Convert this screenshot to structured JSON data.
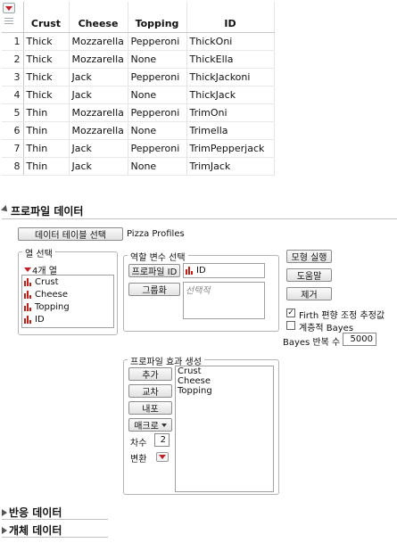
{
  "table": {
    "columns": [
      "Crust",
      "Cheese",
      "Topping",
      "ID"
    ],
    "rows": [
      {
        "n": "1",
        "cells": [
          "Thick",
          "Mozzarella",
          "Pepperoni",
          "ThickOni"
        ]
      },
      {
        "n": "2",
        "cells": [
          "Thick",
          "Mozzarella",
          "None",
          "ThickElla"
        ]
      },
      {
        "n": "3",
        "cells": [
          "Thick",
          "Jack",
          "Pepperoni",
          "ThickJackoni"
        ]
      },
      {
        "n": "4",
        "cells": [
          "Thick",
          "Jack",
          "None",
          "ThickJack"
        ]
      },
      {
        "n": "5",
        "cells": [
          "Thin",
          "Mozzarella",
          "Pepperoni",
          "TrimOni"
        ]
      },
      {
        "n": "6",
        "cells": [
          "Thin",
          "Mozzarella",
          "None",
          "Trimella"
        ]
      },
      {
        "n": "7",
        "cells": [
          "Thin",
          "Jack",
          "Pepperoni",
          "TrimPepperjack"
        ]
      },
      {
        "n": "8",
        "cells": [
          "Thin",
          "Jack",
          "None",
          "TrimJack"
        ]
      }
    ]
  },
  "profile": {
    "title": "프로파일 데이터",
    "select_table_button": "데이터 테이블 선택",
    "table_name": "Pizza Profiles",
    "column_select": {
      "title": "열 선택",
      "count_label": "4개 열",
      "columns": [
        "Crust",
        "Cheese",
        "Topping",
        "ID"
      ]
    },
    "role_select": {
      "title": "역할 변수 선택",
      "profile_id_button": "프로파일 ID",
      "profile_id_value": "ID",
      "group_button": "그룹화",
      "group_placeholder": "선택적"
    },
    "actions": {
      "run": "모형 실행",
      "help": "도움말",
      "remove": "제거"
    },
    "options": {
      "firth_label": "Firth 편향 조정 추정값",
      "firth_checked": true,
      "bayes_label": "계층적 Bayes",
      "bayes_checked": false,
      "bayes_iter_label": "Bayes 반복 수",
      "bayes_iter_value": "5000"
    },
    "effects": {
      "title": "프로파일 효과 생성",
      "add": "추가",
      "cross": "교차",
      "nest": "내포",
      "macro": "매크로",
      "degree_label": "차수",
      "degree_value": "2",
      "transform_label": "변환",
      "items": [
        "Crust",
        "Cheese",
        "Topping"
      ]
    }
  },
  "sections": {
    "response": "반응 데이터",
    "subject": "개체 데이터"
  },
  "colors": {
    "nominal_icon": "#c0201a",
    "red_triangle": "#c0202a"
  }
}
